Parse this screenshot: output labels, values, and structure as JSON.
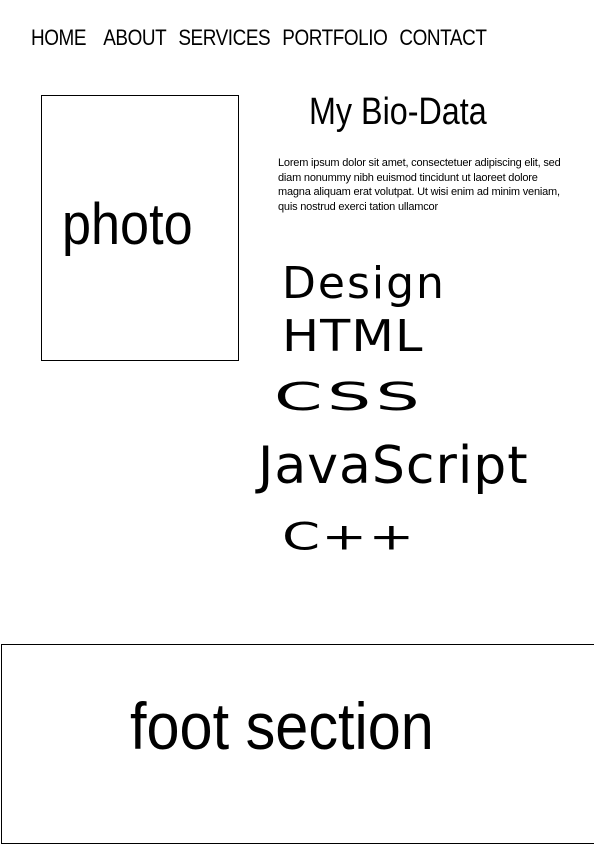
{
  "nav": {
    "items": [
      {
        "label": "HOME"
      },
      {
        "label": "ABOUT"
      },
      {
        "label": "SERVICES"
      },
      {
        "label": "PORTFOLIO"
      },
      {
        "label": "CONTACT"
      }
    ]
  },
  "photo": {
    "label": "photo"
  },
  "bio": {
    "title": "My Bio-Data",
    "text": "Lorem ipsum dolor sit amet, consectetuer adipiscing elit, sed diam nonummy nibh euismod tincidunt ut laoreet dolore magna aliquam erat volutpat. Ut wisi enim ad minim veniam, quis nostrud exerci tation ullamcor"
  },
  "skills": [
    {
      "label": "Design"
    },
    {
      "label": "HTML"
    },
    {
      "label": "CSS"
    },
    {
      "label": "JavaScript"
    },
    {
      "label": "C++"
    }
  ],
  "footer": {
    "label": "foot section"
  }
}
